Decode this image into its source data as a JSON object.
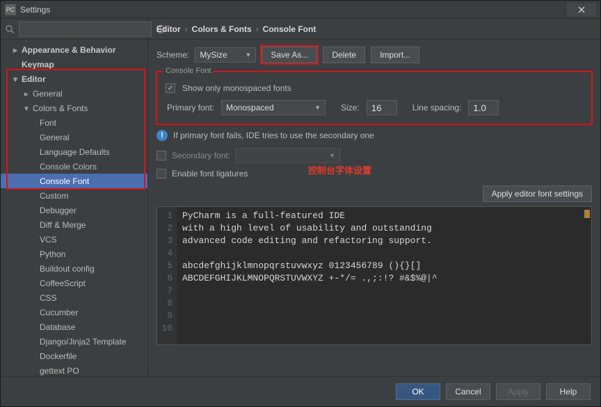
{
  "window": {
    "title": "Settings"
  },
  "breadcrumb": {
    "a": "Editor",
    "b": "Colors & Fonts",
    "c": "Console Font",
    "sep": "›"
  },
  "scheme": {
    "label": "Scheme:",
    "value": "MySize",
    "save_as": "Save As...",
    "delete": "Delete",
    "import": "Import..."
  },
  "console_font": {
    "group_title": "Console Font",
    "show_mono_label": "Show only monospaced fonts",
    "primary_label": "Primary font:",
    "primary_value": "Monospaced",
    "size_label": "Size:",
    "size_value": "16",
    "spacing_label": "Line spacing:",
    "spacing_value": "1.0"
  },
  "info_text": "If primary font fails, IDE tries to use the secondary one",
  "secondary": {
    "label": "Secondary font:"
  },
  "ligatures": {
    "label": "Enable font ligatures"
  },
  "annotation": "控制台字体设置",
  "apply_editor": "Apply editor font settings",
  "preview": {
    "l1": "PyCharm is a full-featured IDE",
    "l2": "with a high level of usability and outstanding",
    "l3": "advanced code editing and refactoring support.",
    "l4": "",
    "l5": "abcdefghijklmnopqrstuvwxyz 0123456789 (){}[]",
    "l6": "ABCDEFGHIJKLMNOPQRSTUVWXYZ +-*/= .,;:!? #&$%@|^",
    "n1": "1",
    "n2": "2",
    "n3": "3",
    "n4": "4",
    "n5": "5",
    "n6": "6",
    "n7": "7",
    "n8": "8",
    "n9": "9",
    "n10": "10"
  },
  "footer": {
    "ok": "OK",
    "cancel": "Cancel",
    "apply": "Apply",
    "help": "Help"
  },
  "tree": {
    "appearance": "Appearance & Behavior",
    "keymap": "Keymap",
    "editor": "Editor",
    "general": "General",
    "colors_fonts": "Colors & Fonts",
    "font": "Font",
    "general2": "General",
    "lang_defaults": "Language Defaults",
    "console_colors": "Console Colors",
    "console_font": "Console Font",
    "custom": "Custom",
    "debugger": "Debugger",
    "diff_merge": "Diff & Merge",
    "vcs": "VCS",
    "python": "Python",
    "buildout": "Buildout config",
    "coffeescript": "CoffeeScript",
    "css": "CSS",
    "cucumber": "Cucumber",
    "database": "Database",
    "django": "Django/Jinja2 Template",
    "dockerfile": "Dockerfile",
    "gettext": "gettext PO"
  }
}
